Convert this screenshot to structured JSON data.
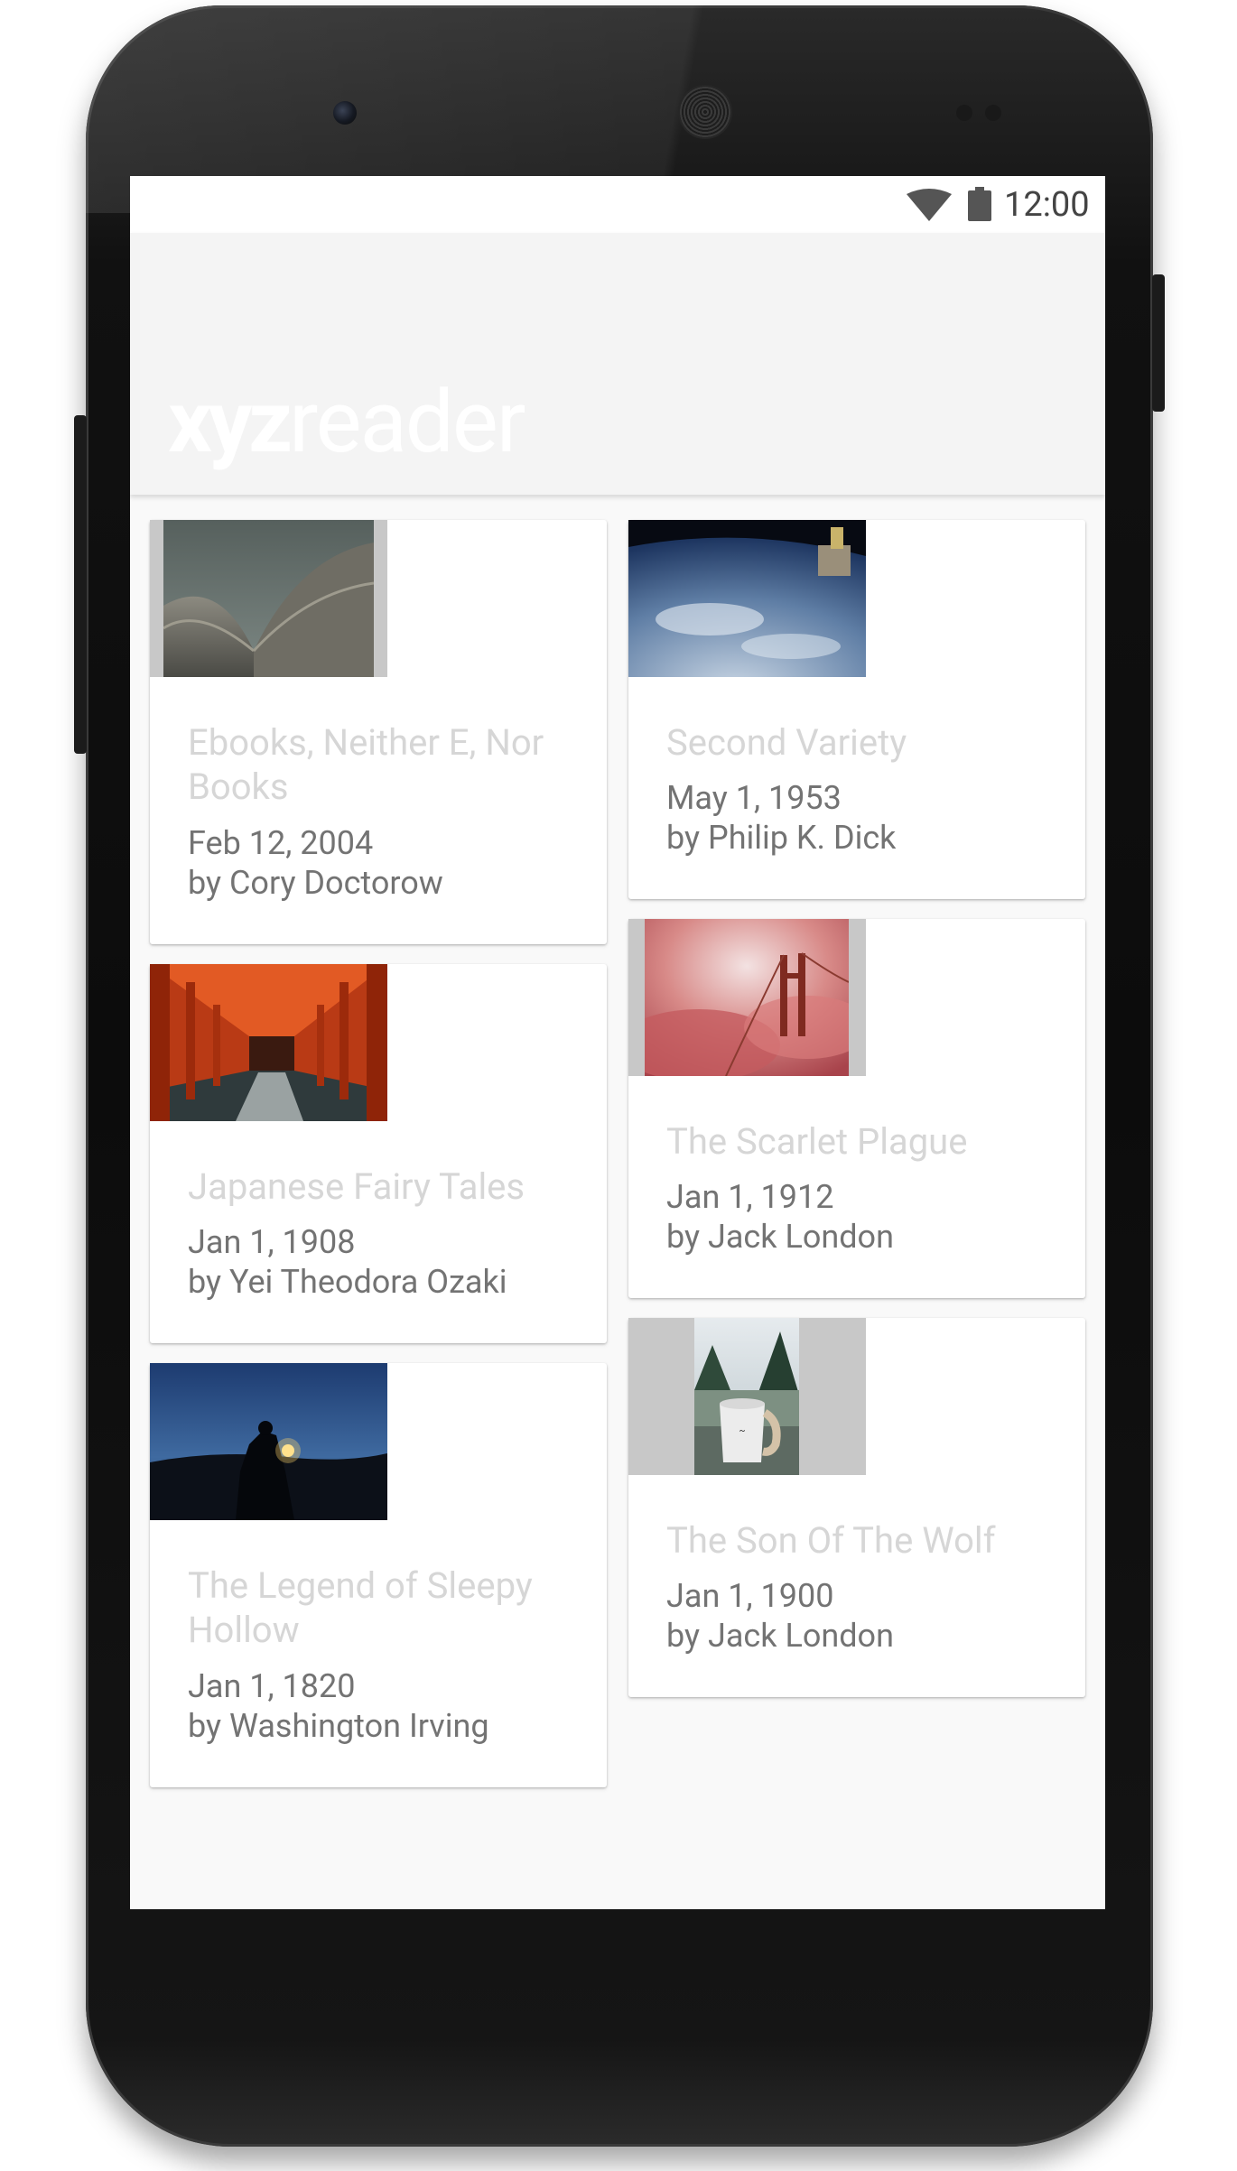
{
  "status_bar": {
    "time": "12:00"
  },
  "app": {
    "logo_bold": "xyz",
    "logo_light": "reader"
  },
  "articles": [
    {
      "title": "Ebooks, Neither E, Nor Books",
      "date": "Feb 12, 2004",
      "author": "by Cory Doctorow",
      "image": "dome-roof-photo"
    },
    {
      "title": "Second Variety",
      "date": "May 1, 1953",
      "author": "by Philip K. Dick",
      "image": "earth-from-space-photo"
    },
    {
      "title": "Japanese Fairy Tales",
      "date": "Jan 1, 1908",
      "author": "by Yei Theodora Ozaki",
      "image": "torii-gates-photo"
    },
    {
      "title": "The Scarlet Plague",
      "date": "Jan 1, 1912",
      "author": "by Jack London",
      "image": "bridge-in-fog-photo"
    },
    {
      "title": "The Legend of Sleepy Hollow",
      "date": "Jan 1, 1820",
      "author": "by Washington Irving",
      "image": "lantern-silhouette-photo"
    },
    {
      "title": "The Son Of The Wolf",
      "date": "Jan 1, 1900",
      "author": "by Jack London",
      "image": "camp-mug-photo"
    }
  ],
  "colors": {
    "screen_background": "#f9f9f9",
    "toolbar_background": "#f4f4f4",
    "title_text": "#d6d6d6",
    "meta_text": "#737373"
  }
}
